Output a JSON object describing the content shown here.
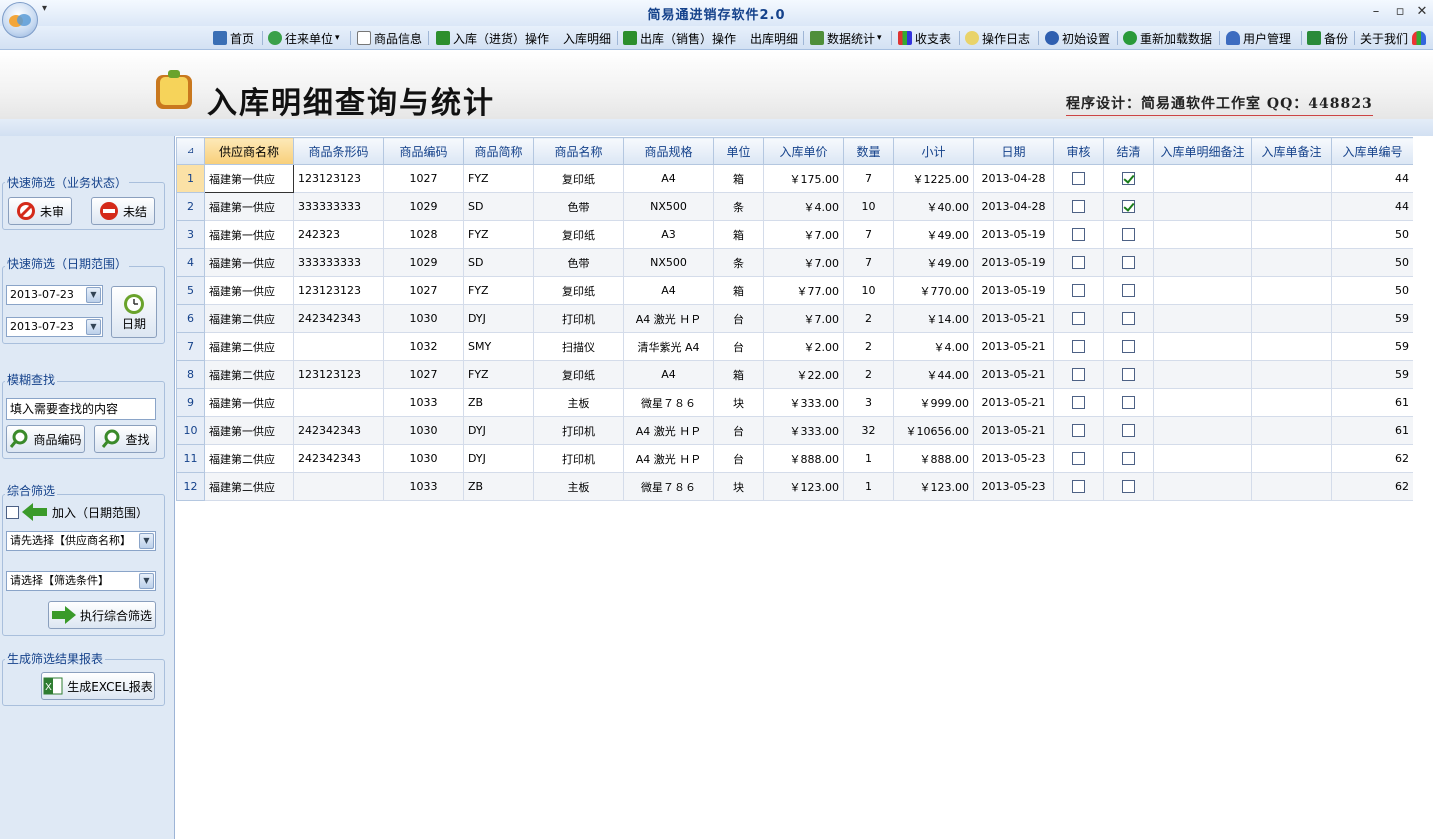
{
  "app": {
    "title": "简易通进销存软件2.0",
    "qa_arrow": "▾",
    "min": "–",
    "max": "▫",
    "close": "✕"
  },
  "toolbar": {
    "home": "首页",
    "partners": "往来单位",
    "partners_arrow": "▾",
    "goods": "商品信息",
    "stock_in": "入库（进货）操作",
    "stock_in_detail": "入库明细",
    "stock_out": "出库（销售）操作",
    "stock_out_detail": "出库明细",
    "stats": "数据统计",
    "stats_arrow": "▾",
    "finance": "收支表",
    "log": "操作日志",
    "init": "初始设置",
    "reload": "重新加载数据",
    "users": "用户管理",
    "backup": "备份",
    "about": "关于我们"
  },
  "banner": {
    "title": "入库明细查询与统计",
    "credit": "程序设计：简易通软件工作室 QQ：448823"
  },
  "left": {
    "status_title": "快速筛选（业务状态）",
    "unaudited": "未审",
    "unsettled": "未结",
    "date_title": "快速筛选（日期范围）",
    "date_from": "2013-07-23",
    "date_to": "2013-07-23",
    "date_btn": "日期",
    "fuzzy_title": "模糊查找",
    "search_placeholder": "填入需要查找的内容",
    "code_btn": "商品编码",
    "find_btn": "查找",
    "combo_title": "综合筛选",
    "add_label": "加入（日期范围）",
    "supplier_select": "请先选择【供应商名称】",
    "cond_select": "请选择【筛选条件】",
    "exec_btn": "执行综合筛选",
    "report_title": "生成筛选结果报表",
    "excel_btn": "生成EXCEL报表"
  },
  "grid": {
    "corner": "⊿",
    "columns": [
      "供应商名称",
      "商品条形码",
      "商品编码",
      "商品简称",
      "商品名称",
      "商品规格",
      "单位",
      "入库单价",
      "数量",
      "小计",
      "日期",
      "审核",
      "结清",
      "入库单明细备注",
      "入库单备注",
      "入库单编号"
    ],
    "rows": [
      {
        "n": "1",
        "supplier": "福建第一供应",
        "barcode": "123123123",
        "code": "1027",
        "abbr": "FYZ",
        "name": "复印纸",
        "spec": "A4",
        "unit": "箱",
        "price": "￥175.00",
        "qty": "7",
        "subtotal": "￥1225.00",
        "date": "2013-04-28",
        "audit": false,
        "settled": true,
        "dnote": "",
        "note": "",
        "no": "44"
      },
      {
        "n": "2",
        "supplier": "福建第一供应",
        "barcode": "333333333",
        "code": "1029",
        "abbr": "SD",
        "name": "色带",
        "spec": "NX500",
        "unit": "条",
        "price": "￥4.00",
        "qty": "10",
        "subtotal": "￥40.00",
        "date": "2013-04-28",
        "audit": false,
        "settled": true,
        "dnote": "",
        "note": "",
        "no": "44"
      },
      {
        "n": "3",
        "supplier": "福建第一供应",
        "barcode": "242323",
        "code": "1028",
        "abbr": "FYZ",
        "name": "复印纸",
        "spec": "A3",
        "unit": "箱",
        "price": "￥7.00",
        "qty": "7",
        "subtotal": "￥49.00",
        "date": "2013-05-19",
        "audit": false,
        "settled": false,
        "dnote": "",
        "note": "",
        "no": "50"
      },
      {
        "n": "4",
        "supplier": "福建第一供应",
        "barcode": "333333333",
        "code": "1029",
        "abbr": "SD",
        "name": "色带",
        "spec": "NX500",
        "unit": "条",
        "price": "￥7.00",
        "qty": "7",
        "subtotal": "￥49.00",
        "date": "2013-05-19",
        "audit": false,
        "settled": false,
        "dnote": "",
        "note": "",
        "no": "50"
      },
      {
        "n": "5",
        "supplier": "福建第一供应",
        "barcode": "123123123",
        "code": "1027",
        "abbr": "FYZ",
        "name": "复印纸",
        "spec": "A4",
        "unit": "箱",
        "price": "￥77.00",
        "qty": "10",
        "subtotal": "￥770.00",
        "date": "2013-05-19",
        "audit": false,
        "settled": false,
        "dnote": "",
        "note": "",
        "no": "50"
      },
      {
        "n": "6",
        "supplier": "福建第二供应",
        "barcode": "242342343",
        "code": "1030",
        "abbr": "DYJ",
        "name": "打印机",
        "spec": "A4 激光 ＨＰ",
        "unit": "台",
        "price": "￥7.00",
        "qty": "2",
        "subtotal": "￥14.00",
        "date": "2013-05-21",
        "audit": false,
        "settled": false,
        "dnote": "",
        "note": "",
        "no": "59"
      },
      {
        "n": "7",
        "supplier": "福建第二供应",
        "barcode": "",
        "code": "1032",
        "abbr": "SMY",
        "name": "扫描仪",
        "spec": "清华紫光  A4",
        "unit": "台",
        "price": "￥2.00",
        "qty": "2",
        "subtotal": "￥4.00",
        "date": "2013-05-21",
        "audit": false,
        "settled": false,
        "dnote": "",
        "note": "",
        "no": "59"
      },
      {
        "n": "8",
        "supplier": "福建第二供应",
        "barcode": "123123123",
        "code": "1027",
        "abbr": "FYZ",
        "name": "复印纸",
        "spec": "A4",
        "unit": "箱",
        "price": "￥22.00",
        "qty": "2",
        "subtotal": "￥44.00",
        "date": "2013-05-21",
        "audit": false,
        "settled": false,
        "dnote": "",
        "note": "",
        "no": "59"
      },
      {
        "n": "9",
        "supplier": "福建第一供应",
        "barcode": "",
        "code": "1033",
        "abbr": "ZB",
        "name": "主板",
        "spec": "微星７８６",
        "unit": "块",
        "price": "￥333.00",
        "qty": "3",
        "subtotal": "￥999.00",
        "date": "2013-05-21",
        "audit": false,
        "settled": false,
        "dnote": "",
        "note": "",
        "no": "61"
      },
      {
        "n": "10",
        "supplier": "福建第一供应",
        "barcode": "242342343",
        "code": "1030",
        "abbr": "DYJ",
        "name": "打印机",
        "spec": "A4 激光 ＨＰ",
        "unit": "台",
        "price": "￥333.00",
        "qty": "32",
        "subtotal": "￥10656.00",
        "date": "2013-05-21",
        "audit": false,
        "settled": false,
        "dnote": "",
        "note": "",
        "no": "61"
      },
      {
        "n": "11",
        "supplier": "福建第二供应",
        "barcode": "242342343",
        "code": "1030",
        "abbr": "DYJ",
        "name": "打印机",
        "spec": "A4 激光 ＨＰ",
        "unit": "台",
        "price": "￥888.00",
        "qty": "1",
        "subtotal": "￥888.00",
        "date": "2013-05-23",
        "audit": false,
        "settled": false,
        "dnote": "",
        "note": "",
        "no": "62"
      },
      {
        "n": "12",
        "supplier": "福建第二供应",
        "barcode": "",
        "code": "1033",
        "abbr": "ZB",
        "name": "主板",
        "spec": "微星７８６",
        "unit": "块",
        "price": "￥123.00",
        "qty": "1",
        "subtotal": "￥123.00",
        "date": "2013-05-23",
        "audit": false,
        "settled": false,
        "dnote": "",
        "note": "",
        "no": "62"
      }
    ]
  }
}
